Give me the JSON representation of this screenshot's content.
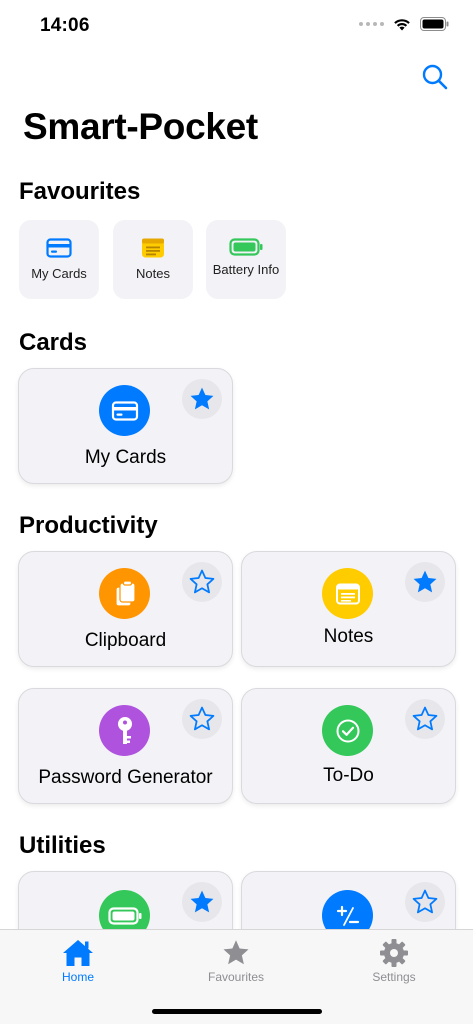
{
  "status_bar": {
    "time": "14:06"
  },
  "header": {
    "title": "Smart-Pocket"
  },
  "sections": {
    "favourites": "Favourites",
    "cards": "Cards",
    "productivity": "Productivity",
    "utilities": "Utilities"
  },
  "favourites": [
    {
      "label": "My Cards",
      "icon": "credit-card-icon",
      "color": "#007aff"
    },
    {
      "label": "Notes",
      "icon": "note-icon",
      "color": "#ffcc00"
    },
    {
      "label": "Battery Info",
      "icon": "battery-icon",
      "color": "#34c759"
    }
  ],
  "cards": {
    "my_cards": {
      "label": "My Cards",
      "icon": "credit-card-icon",
      "color": "#007aff",
      "favourite": true
    }
  },
  "productivity": {
    "clipboard": {
      "label": "Clipboard",
      "icon": "clipboard-icon",
      "color": "#ff9500",
      "favourite": false
    },
    "notes": {
      "label": "Notes",
      "icon": "note-icon",
      "color": "#ffcc00",
      "favourite": true
    },
    "password_generator": {
      "label": "Password Generator",
      "icon": "key-icon",
      "color": "#af52de",
      "favourite": false
    },
    "todo": {
      "label": "To-Do",
      "icon": "checkmark-icon",
      "color": "#34c759",
      "favourite": false
    }
  },
  "utilities": {
    "battery": {
      "icon": "battery-icon",
      "color": "#34c759",
      "favourite": true
    },
    "calculator": {
      "icon": "plus-minus-icon",
      "color": "#007aff",
      "favourite": false
    }
  },
  "tab_bar": {
    "home": "Home",
    "favourites": "Favourites",
    "settings": "Settings",
    "active_color": "#007aff",
    "inactive_color": "#8e8e93"
  }
}
